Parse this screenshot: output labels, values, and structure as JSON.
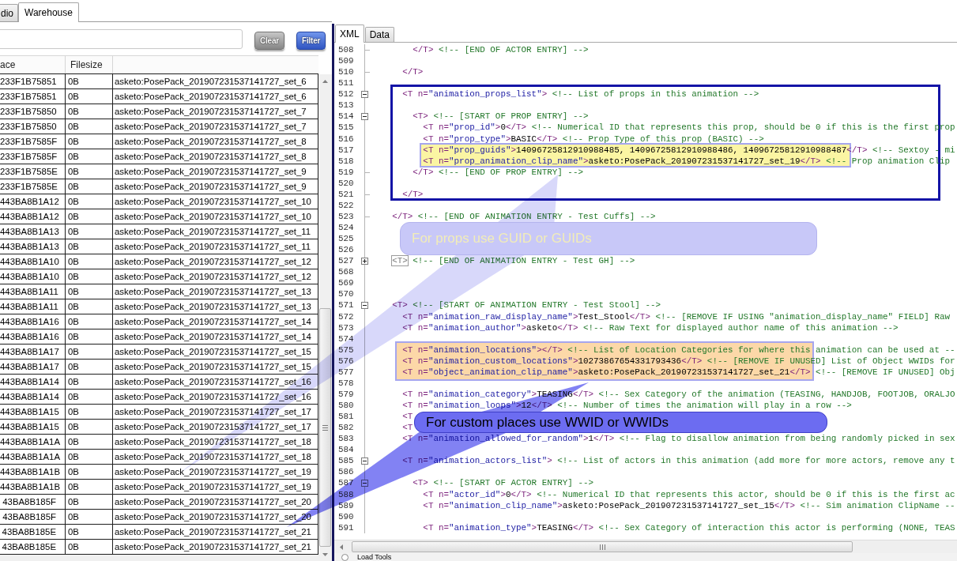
{
  "left_panel": {
    "tabs": [
      {
        "label": "dio",
        "selected": false
      },
      {
        "label": "Warehouse",
        "selected": true
      }
    ],
    "buttons": [
      {
        "label": "Clear",
        "kind": "secondary"
      },
      {
        "label": "Filter",
        "kind": "primary"
      }
    ],
    "table": {
      "columns": [
        "ace",
        "Filesize"
      ],
      "rows": [
        [
          "233F1B75851",
          "0B",
          "asketo:PosePack_201907231537141727_set_6"
        ],
        [
          "233F1B75851",
          "0B",
          "asketo:PosePack_201907231537141727_set_6"
        ],
        [
          "233F1B75850",
          "0B",
          "asketo:PosePack_201907231537141727_set_7"
        ],
        [
          "233F1B75850",
          "0B",
          "asketo:PosePack_201907231537141727_set_7"
        ],
        [
          "233F1B7585F",
          "0B",
          "asketo:PosePack_201907231537141727_set_8"
        ],
        [
          "233F1B7585F",
          "0B",
          "asketo:PosePack_201907231537141727_set_8"
        ],
        [
          "233F1B7585E",
          "0B",
          "asketo:PosePack_201907231537141727_set_9"
        ],
        [
          "233F1B7585E",
          "0B",
          "asketo:PosePack_201907231537141727_set_9"
        ],
        [
          "443BA8B1A12",
          "0B",
          "asketo:PosePack_201907231537141727_set_10"
        ],
        [
          "443BA8B1A12",
          "0B",
          "asketo:PosePack_201907231537141727_set_10"
        ],
        [
          "443BA8B1A13",
          "0B",
          "asketo:PosePack_201907231537141727_set_11"
        ],
        [
          "443BA8B1A13",
          "0B",
          "asketo:PosePack_201907231537141727_set_11"
        ],
        [
          "443BA8B1A10",
          "0B",
          "asketo:PosePack_201907231537141727_set_12"
        ],
        [
          "443BA8B1A10",
          "0B",
          "asketo:PosePack_201907231537141727_set_12"
        ],
        [
          "443BA8B1A11",
          "0B",
          "asketo:PosePack_201907231537141727_set_13"
        ],
        [
          "443BA8B1A11",
          "0B",
          "asketo:PosePack_201907231537141727_set_13"
        ],
        [
          "443BA8B1A16",
          "0B",
          "asketo:PosePack_201907231537141727_set_14"
        ],
        [
          "443BA8B1A16",
          "0B",
          "asketo:PosePack_201907231537141727_set_14"
        ],
        [
          "443BA8B1A17",
          "0B",
          "asketo:PosePack_201907231537141727_set_15"
        ],
        [
          "443BA8B1A17",
          "0B",
          "asketo:PosePack_201907231537141727_set_15"
        ],
        [
          "443BA8B1A14",
          "0B",
          "asketo:PosePack_201907231537141727_set_16"
        ],
        [
          "443BA8B1A14",
          "0B",
          "asketo:PosePack_201907231537141727_set_16"
        ],
        [
          "443BA8B1A15",
          "0B",
          "asketo:PosePack_201907231537141727_set_17"
        ],
        [
          "443BA8B1A15",
          "0B",
          "asketo:PosePack_201907231537141727_set_17"
        ],
        [
          "443BA8B1A1A",
          "0B",
          "asketo:PosePack_201907231537141727_set_18"
        ],
        [
          "443BA8B1A1A",
          "0B",
          "asketo:PosePack_201907231537141727_set_18"
        ],
        [
          "443BA8B1A1B",
          "0B",
          "asketo:PosePack_201907231537141727_set_19"
        ],
        [
          "443BA8B1A1B",
          "0B",
          "asketo:PosePack_201907231537141727_set_19"
        ],
        [
          "43BA8B185F",
          "0B",
          "asketo:PosePack_201907231537141727_set_20"
        ],
        [
          "43BA8B185F",
          "0B",
          "asketo:PosePack_201907231537141727_set_20"
        ],
        [
          "43BA8B185E",
          "0B",
          "asketo:PosePack_201907231537141727_set_21"
        ],
        [
          "43BA8B185E",
          "0B",
          "asketo:PosePack_201907231537141727_set_21"
        ]
      ]
    }
  },
  "right_panel": {
    "tabs": [
      {
        "label": "XML",
        "selected": true
      },
      {
        "label": "Data",
        "selected": false
      }
    ],
    "lines": [
      {
        "number": "508",
        "kind": "end",
        "code": [
          {
            "kind": "tag",
            "text": "        </T>"
          },
          {
            "kind": "comment",
            "text": " <!-- [END OF ACTOR ENTRY] -->"
          }
        ]
      },
      {
        "number": "509",
        "kind": "line"
      },
      {
        "number": "510",
        "kind": "end",
        "code": [
          {
            "kind": "tag",
            "text": "      </T>"
          }
        ]
      },
      {
        "number": "511",
        "kind": "line"
      },
      {
        "number": "512",
        "kind": "collapse",
        "code": [
          {
            "kind": "tag",
            "text": "      <T n="
          },
          {
            "kind": "value",
            "text": "\"animation_props_list\""
          },
          {
            "kind": "tag",
            "text": ">"
          },
          {
            "kind": "comment",
            "text": " <!-- List of props in this animation -->"
          }
        ]
      },
      {
        "number": "513",
        "kind": "line"
      },
      {
        "number": "514",
        "kind": "collapse",
        "code": [
          {
            "kind": "tag",
            "text": "        <T>"
          },
          {
            "kind": "comment",
            "text": " <!-- [START OF PROP ENTRY] -->"
          }
        ]
      },
      {
        "number": "515",
        "kind": "line",
        "code": [
          {
            "kind": "tag",
            "text": "          <T n="
          },
          {
            "kind": "value",
            "text": "\"prop_id\""
          },
          {
            "kind": "tag",
            "text": ">"
          },
          {
            "kind": "text",
            "text": "0"
          },
          {
            "kind": "tag",
            "text": "</T>"
          },
          {
            "kind": "comment",
            "text": " <!-- Numerical ID that represents this prop, should be 0 if this is the first prop"
          }
        ]
      },
      {
        "number": "516",
        "kind": "line",
        "code": [
          {
            "kind": "tag",
            "text": "          <T n="
          },
          {
            "kind": "value",
            "text": "\"prop_type\""
          },
          {
            "kind": "tag",
            "text": ">"
          },
          {
            "kind": "text",
            "text": "BASIC"
          },
          {
            "kind": "tag",
            "text": "</T>"
          },
          {
            "kind": "comment",
            "text": " <!-- Prop Type of this prop (BASIC) -->"
          }
        ]
      },
      {
        "number": "517",
        "kind": "line",
        "code": [
          {
            "kind": "tag",
            "text": "          <T n="
          },
          {
            "kind": "value",
            "text": "\"prop_guids\""
          },
          {
            "kind": "tag",
            "text": ">"
          },
          {
            "kind": "text",
            "text": "14096725812910988485, 14096725812910988486, 14096725812910988487"
          },
          {
            "kind": "tag",
            "text": "</T>"
          },
          {
            "kind": "comment",
            "text": " <!-- Sextoy - mi"
          }
        ]
      },
      {
        "number": "518",
        "kind": "line",
        "code": [
          {
            "kind": "tag",
            "text": "          <T n="
          },
          {
            "kind": "value",
            "text": "\"prop_animation_clip_name\""
          },
          {
            "kind": "tag",
            "text": ">"
          },
          {
            "kind": "text",
            "text": "asketo:PosePack_201907231537141727_set_19"
          },
          {
            "kind": "tag",
            "text": "</T>"
          },
          {
            "kind": "comment",
            "text": " <!-- Prop animation Clip"
          }
        ]
      },
      {
        "number": "519",
        "kind": "end",
        "code": [
          {
            "kind": "tag",
            "text": "        </T>"
          },
          {
            "kind": "comment",
            "text": " <!-- [END OF PROP ENTRY] -->"
          }
        ]
      },
      {
        "number": "520",
        "kind": "line"
      },
      {
        "number": "521",
        "kind": "end",
        "code": [
          {
            "kind": "tag",
            "text": "      </T>"
          }
        ]
      },
      {
        "number": "522",
        "kind": "line"
      },
      {
        "number": "523",
        "kind": "end",
        "code": [
          {
            "kind": "tag",
            "text": "    </T>"
          },
          {
            "kind": "comment",
            "text": " <!-- [END OF ANIMATION ENTRY - Test Cuffs] -->"
          }
        ]
      },
      {
        "number": "524",
        "kind": "line"
      },
      {
        "number": "525",
        "kind": "line"
      },
      {
        "number": "526",
        "kind": "line"
      },
      {
        "number": "527",
        "kind": "expand",
        "code": [
          {
            "kind": "folded",
            "text": "    <T>"
          },
          {
            "kind": "comment",
            "text": " <!-- [END OF ANIMATION ENTRY - Test GH] -->"
          }
        ]
      },
      {
        "number": "568",
        "kind": "line"
      },
      {
        "number": "569",
        "kind": "line"
      },
      {
        "number": "570",
        "kind": "line"
      },
      {
        "number": "571",
        "kind": "collapse",
        "code": [
          {
            "kind": "tag",
            "text": "    <T>"
          },
          {
            "kind": "comment",
            "text": " <!-- [START OF ANIMATION ENTRY - Test Stool] -->"
          }
        ]
      },
      {
        "number": "572",
        "kind": "line",
        "code": [
          {
            "kind": "tag",
            "text": "      <T n="
          },
          {
            "kind": "value",
            "text": "\"animation_raw_display_name\""
          },
          {
            "kind": "tag",
            "text": ">"
          },
          {
            "kind": "text",
            "text": "Test_Stool"
          },
          {
            "kind": "tag",
            "text": "</T>"
          },
          {
            "kind": "comment",
            "text": " <!-- [REMOVE IF USING \"animation_display_name\" FIELD] Raw"
          }
        ]
      },
      {
        "number": "573",
        "kind": "line",
        "code": [
          {
            "kind": "tag",
            "text": "      <T n="
          },
          {
            "kind": "value",
            "text": "\"animation_author\""
          },
          {
            "kind": "tag",
            "text": ">"
          },
          {
            "kind": "text",
            "text": "asketo"
          },
          {
            "kind": "tag",
            "text": "</T>"
          },
          {
            "kind": "comment",
            "text": " <!-- Raw Text for displayed author name of this animation -->"
          }
        ]
      },
      {
        "number": "574",
        "kind": "line"
      },
      {
        "number": "575",
        "kind": "line",
        "code": [
          {
            "kind": "tag",
            "text": "      <T n="
          },
          {
            "kind": "value",
            "text": "\"animation_locations\""
          },
          {
            "kind": "tag",
            "text": "></T>"
          },
          {
            "kind": "comment",
            "text": " <!-- List of Location Categories for where this animation can be used at --"
          }
        ]
      },
      {
        "number": "576",
        "kind": "line",
        "code": [
          {
            "kind": "tag",
            "text": "      <T n="
          },
          {
            "kind": "value",
            "text": "\"animation_custom_locations\""
          },
          {
            "kind": "tag",
            "text": ">"
          },
          {
            "kind": "text",
            "text": "10273867654331793436"
          },
          {
            "kind": "tag",
            "text": "</T>"
          },
          {
            "kind": "comment",
            "text": " <!-- [REMOVE IF UNUSED] List of Object WWIDs for"
          }
        ]
      },
      {
        "number": "577",
        "kind": "line",
        "code": [
          {
            "kind": "tag",
            "text": "      <T n="
          },
          {
            "kind": "value",
            "text": "\"object_animation_clip_name\""
          },
          {
            "kind": "tag",
            "text": ">"
          },
          {
            "kind": "text",
            "text": "asketo:PosePack_201907231537141727_set_21"
          },
          {
            "kind": "tag",
            "text": "</T>"
          },
          {
            "kind": "comment",
            "text": " <!-- [REMOVE IF UNUSED] Obj"
          }
        ]
      },
      {
        "number": "578",
        "kind": "line"
      },
      {
        "number": "579",
        "kind": "line",
        "code": [
          {
            "kind": "tag",
            "text": "      <T n="
          },
          {
            "kind": "value",
            "text": "\"animation_category\""
          },
          {
            "kind": "tag",
            "text": ">"
          },
          {
            "kind": "text",
            "text": "TEASING"
          },
          {
            "kind": "tag",
            "text": "</T>"
          },
          {
            "kind": "comment",
            "text": " <!-- Sex Category of the animation (TEASING, HANDJOB, FOOTJOB, ORALJO"
          }
        ]
      },
      {
        "number": "580",
        "kind": "line",
        "code": [
          {
            "kind": "tag",
            "text": "      <T n="
          },
          {
            "kind": "value",
            "text": "\"animation_loops\""
          },
          {
            "kind": "tag",
            "text": ">"
          },
          {
            "kind": "text",
            "text": "12"
          },
          {
            "kind": "tag",
            "text": "</T>"
          },
          {
            "kind": "comment",
            "text": " <!-- Number of times the animation will play in a row -->"
          }
        ]
      },
      {
        "number": "581",
        "kind": "line",
        "code": [
          {
            "kind": "tag",
            "text": "      <T"
          }
        ]
      },
      {
        "number": "582",
        "kind": "line",
        "code": [
          {
            "kind": "tag",
            "text": "      <T"
          }
        ]
      },
      {
        "number": "583",
        "kind": "line",
        "code": [
          {
            "kind": "tag",
            "text": "      <T n="
          },
          {
            "kind": "value",
            "text": "\"animation_allowed_for_random\""
          },
          {
            "kind": "tag",
            "text": ">"
          },
          {
            "kind": "text",
            "text": "1"
          },
          {
            "kind": "tag",
            "text": "</T>"
          },
          {
            "kind": "comment",
            "text": " <!-- Flag to disallow animation from being randomly picked in sex"
          }
        ]
      },
      {
        "number": "584",
        "kind": "line"
      },
      {
        "number": "585",
        "kind": "collapse",
        "code": [
          {
            "kind": "tag",
            "text": "      <T n="
          },
          {
            "kind": "value",
            "text": "\"animation_actors_list\""
          },
          {
            "kind": "tag",
            "text": ">"
          },
          {
            "kind": "comment",
            "text": " <!-- List of actors in this animation (add more for more actors, remove any t"
          }
        ]
      },
      {
        "number": "586",
        "kind": "line"
      },
      {
        "number": "587",
        "kind": "collapse",
        "code": [
          {
            "kind": "tag",
            "text": "        <T>"
          },
          {
            "kind": "comment",
            "text": " <!-- [START OF ACTOR ENTRY] -->"
          }
        ]
      },
      {
        "number": "588",
        "kind": "line",
        "code": [
          {
            "kind": "tag",
            "text": "          <T n="
          },
          {
            "kind": "value",
            "text": "\"actor_id\""
          },
          {
            "kind": "tag",
            "text": ">"
          },
          {
            "kind": "text",
            "text": "0"
          },
          {
            "kind": "tag",
            "text": "</T>"
          },
          {
            "kind": "comment",
            "text": " <!-- Numerical ID that represents this actor, should be 0 if this is the first ac"
          }
        ]
      },
      {
        "number": "589",
        "kind": "line",
        "code": [
          {
            "kind": "tag",
            "text": "          <T n="
          },
          {
            "kind": "value",
            "text": "\"animation_clip_name\""
          },
          {
            "kind": "tag",
            "text": ">"
          },
          {
            "kind": "text",
            "text": "asketo:PosePack_201907231537141727_set_15"
          },
          {
            "kind": "tag",
            "text": "</T>"
          },
          {
            "kind": "comment",
            "text": " <!-- Sim animation ClipName --"
          }
        ]
      },
      {
        "number": "590",
        "kind": "line"
      },
      {
        "number": "591",
        "kind": "line",
        "code": [
          {
            "kind": "tag",
            "text": "          <T n="
          },
          {
            "kind": "value",
            "text": "\"animation_type\""
          },
          {
            "kind": "tag",
            "text": ">"
          },
          {
            "kind": "text",
            "text": "TEASING"
          },
          {
            "kind": "tag",
            "text": "</T>"
          },
          {
            "kind": "comment",
            "text": " <!-- Sex Category of interaction this actor is performing (NONE, TEAS"
          }
        ]
      }
    ],
    "radio": {
      "label": "Load Tools"
    }
  },
  "annotations": [
    {
      "kind": "frame"
    },
    {
      "kind": "highlight",
      "color": "#fbf5a3"
    },
    {
      "kind": "note",
      "text": "For props use GUID or GUIDs",
      "color": "#c8c8f8"
    },
    {
      "kind": "highlight",
      "color": "#fcd8a8"
    },
    {
      "kind": "callout",
      "text": "For custom places use WWID or WWIDs",
      "color": "#6c6cf1"
    }
  ]
}
